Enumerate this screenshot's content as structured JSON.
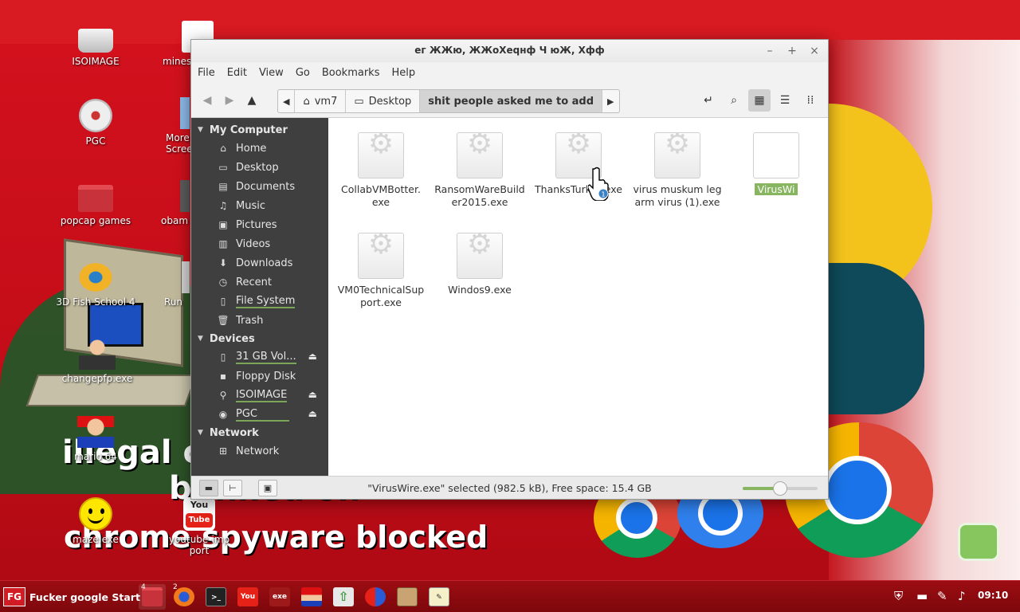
{
  "wallpaper": {
    "line1": "illegal ci",
    "line2": "banned on",
    "line3": "chrome spyware blocked"
  },
  "desktop_icons": [
    {
      "name": "desktop-icon-isoimage",
      "label": "ISOIMAGE",
      "icon": "usb-drive-icon"
    },
    {
      "name": "desktop-icon-minesweeper",
      "label": "mines",
      "icon": "windows-flag-icon"
    },
    {
      "name": "desktop-icon-pgc",
      "label": "PGC",
      "icon": "cd-icon"
    },
    {
      "name": "desktop-icon-more-screens",
      "label": "More Scree",
      "icon": "screen-icon"
    },
    {
      "name": "desktop-icon-popcap-games",
      "label": "popcap games",
      "icon": "folder-icon"
    },
    {
      "name": "desktop-icon-obama",
      "label": "obam",
      "icon": "image-icon"
    },
    {
      "name": "desktop-icon-3d-fish-school",
      "label": "3D Fish School 4",
      "icon": "fish-icon"
    },
    {
      "name": "desktop-icon-run",
      "label": "Run",
      "icon": "run-icon"
    },
    {
      "name": "desktop-icon-changepfp",
      "label": "changepfp.exe",
      "icon": "person-icon"
    },
    {
      "name": "desktop-icon-mario-64",
      "label": "mario 64",
      "icon": "mario-icon"
    },
    {
      "name": "desktop-icon-maze",
      "label": "maze.exe",
      "icon": "smiley-icon"
    },
    {
      "name": "desktop-icon-youtube-import",
      "label": "youtube-imp port",
      "icon": "youtube-icon"
    }
  ],
  "window": {
    "title": "ег ЖЖю, ЖЖоХеqнф Ч юЖ, Хфф",
    "controls": {
      "minimize": "–",
      "maximize": "+",
      "close": "×"
    },
    "menu": [
      "File",
      "Edit",
      "View",
      "Go",
      "Bookmarks",
      "Help"
    ],
    "breadcrumbs": [
      "vm7",
      "Desktop",
      "shit people asked me to add"
    ],
    "sidebar": {
      "sections": [
        {
          "title": "My Computer",
          "items": [
            {
              "label": "Home",
              "icon": "home-icon"
            },
            {
              "label": "Desktop",
              "icon": "desktop-icon"
            },
            {
              "label": "Documents",
              "icon": "documents-icon"
            },
            {
              "label": "Music",
              "icon": "music-icon"
            },
            {
              "label": "Pictures",
              "icon": "pictures-icon"
            },
            {
              "label": "Videos",
              "icon": "videos-icon"
            },
            {
              "label": "Downloads",
              "icon": "downloads-icon"
            },
            {
              "label": "Recent",
              "icon": "recent-icon"
            },
            {
              "label": "File System",
              "icon": "drive-icon"
            },
            {
              "label": "Trash",
              "icon": "trash-icon"
            }
          ]
        },
        {
          "title": "Devices",
          "items": [
            {
              "label": "31 GB Vol...",
              "icon": "drive-icon"
            },
            {
              "label": "Floppy Disk",
              "icon": "floppy-icon"
            },
            {
              "label": "ISOIMAGE",
              "icon": "usb-icon"
            },
            {
              "label": "PGC",
              "icon": "cd-icon"
            }
          ]
        },
        {
          "title": "Network",
          "items": [
            {
              "label": "Network",
              "icon": "network-icon"
            }
          ]
        }
      ]
    },
    "files": [
      {
        "name": "CollabVMBotter.\nexe"
      },
      {
        "name": "RansomWareBuild\ner2015.exe"
      },
      {
        "name": "ThanksTurkey.exe"
      },
      {
        "name": "virus muskum leg\narm virus (1).exe"
      },
      {
        "name": "VirusWi",
        "selected": true
      },
      {
        "name": "VM0TechnicalSup\nport.exe"
      },
      {
        "name": "Windos9.exe"
      }
    ],
    "status": "\"VirusWire.exe\" selected (982.5 kB), Free space: 15.4 GB",
    "zoom_level": 0.5
  },
  "taskbar": {
    "start_label": "Fucker google Start",
    "start_logo": "FG",
    "launchers": [
      {
        "name": "taskbar-files",
        "icon": "folder-icon",
        "badge": "4"
      },
      {
        "name": "taskbar-firefox",
        "icon": "firefox-icon",
        "badge": "2"
      },
      {
        "name": "taskbar-terminal",
        "icon": "terminal-icon",
        "badge": ""
      },
      {
        "name": "taskbar-youtube",
        "icon": "youtube-icon",
        "badge": ""
      },
      {
        "name": "taskbar-youtube-exe",
        "icon": "youtube-exe-icon",
        "badge": ""
      },
      {
        "name": "taskbar-mario",
        "icon": "mario-icon",
        "badge": ""
      },
      {
        "name": "taskbar-update",
        "icon": "shield-update-icon",
        "badge": ""
      },
      {
        "name": "taskbar-browser",
        "icon": "browser-icon",
        "badge": ""
      },
      {
        "name": "taskbar-archive",
        "icon": "archive-icon",
        "badge": ""
      },
      {
        "name": "taskbar-editor",
        "icon": "text-editor-icon",
        "badge": ""
      }
    ],
    "clock": "09:10"
  }
}
